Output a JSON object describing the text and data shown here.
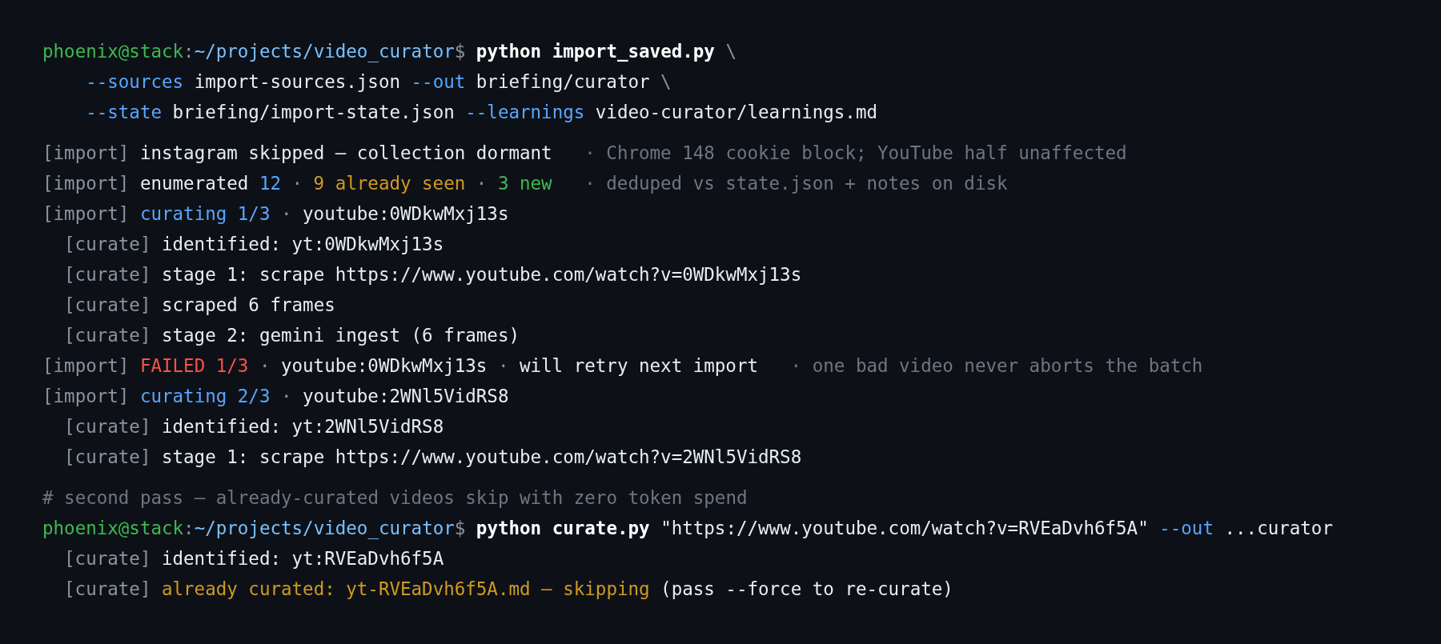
{
  "blocks": [
    {
      "lines": [
        {
          "kind": "command",
          "prompt": {
            "user": "phoenix@stack",
            "sep": ":",
            "path": "~/projects/video_curator",
            "sign": "$"
          },
          "segments": [
            {
              "kind": "bold",
              "text": "python import_saved.py"
            },
            {
              "kind": "dim",
              "text": "\\"
            }
          ]
        },
        {
          "kind": "continuation",
          "segments": [
            {
              "kind": "flag",
              "text": "--sources"
            },
            {
              "kind": "text",
              "text": "import-sources.json"
            },
            {
              "kind": "flag",
              "text": "--out"
            },
            {
              "kind": "text",
              "text": "briefing/curator"
            },
            {
              "kind": "dim",
              "text": "\\"
            }
          ]
        },
        {
          "kind": "continuation",
          "segments": [
            {
              "kind": "flag",
              "text": "--state"
            },
            {
              "kind": "text",
              "text": "briefing/import-state.json"
            },
            {
              "kind": "flag",
              "text": "--learnings"
            },
            {
              "kind": "text",
              "text": "video-curator/learnings.md"
            }
          ]
        }
      ]
    },
    {
      "lines": [
        {
          "kind": "log",
          "segments": [
            {
              "kind": "dim",
              "text": "[import]"
            },
            {
              "kind": "text",
              "text": "instagram skipped — collection dormant"
            },
            {
              "kind": "note",
              "text": "· Chrome 148 cookie block; YouTube half unaffected"
            }
          ]
        },
        {
          "kind": "log",
          "segments": [
            {
              "kind": "dim",
              "text": "[import]"
            },
            {
              "kind": "text",
              "text": "enumerated"
            },
            {
              "kind": "accent",
              "text": "12"
            },
            {
              "kind": "dim",
              "text": "·"
            },
            {
              "kind": "warn",
              "text": "9 already seen"
            },
            {
              "kind": "dim",
              "text": "·"
            },
            {
              "kind": "ok",
              "text": "3 new"
            },
            {
              "kind": "note",
              "text": "· deduped vs state.json + notes on disk"
            }
          ]
        },
        {
          "kind": "log",
          "segments": [
            {
              "kind": "dim",
              "text": "[import]"
            },
            {
              "kind": "accent",
              "text": "curating 1/3"
            },
            {
              "kind": "dim",
              "text": "·"
            },
            {
              "kind": "text",
              "text": "youtube:0WDkwMxj13s"
            }
          ]
        },
        {
          "kind": "sublog",
          "segments": [
            {
              "kind": "dim",
              "text": "[curate]"
            },
            {
              "kind": "text",
              "text": "identified: yt:0WDkwMxj13s"
            }
          ]
        },
        {
          "kind": "sublog",
          "segments": [
            {
              "kind": "dim",
              "text": "[curate]"
            },
            {
              "kind": "text",
              "text": "stage 1: scrape https://www.youtube.com/watch?v=0WDkwMxj13s"
            }
          ]
        },
        {
          "kind": "sublog",
          "segments": [
            {
              "kind": "dim",
              "text": "[curate]"
            },
            {
              "kind": "text",
              "text": "scraped 6 frames"
            }
          ]
        },
        {
          "kind": "sublog",
          "segments": [
            {
              "kind": "dim",
              "text": "[curate]"
            },
            {
              "kind": "text",
              "text": "stage 2: gemini ingest (6 frames)"
            }
          ]
        },
        {
          "kind": "log",
          "segments": [
            {
              "kind": "dim",
              "text": "[import]"
            },
            {
              "kind": "error",
              "text": "FAILED 1/3"
            },
            {
              "kind": "dim",
              "text": "·"
            },
            {
              "kind": "text",
              "text": "youtube:0WDkwMxj13s"
            },
            {
              "kind": "dim",
              "text": "·"
            },
            {
              "kind": "text",
              "text": "will retry next import"
            },
            {
              "kind": "note",
              "text": "· one bad video never aborts the batch"
            }
          ]
        },
        {
          "kind": "log",
          "segments": [
            {
              "kind": "dim",
              "text": "[import]"
            },
            {
              "kind": "accent",
              "text": "curating 2/3"
            },
            {
              "kind": "dim",
              "text": "·"
            },
            {
              "kind": "text",
              "text": "youtube:2WNl5VidRS8"
            }
          ]
        },
        {
          "kind": "sublog",
          "segments": [
            {
              "kind": "dim",
              "text": "[curate]"
            },
            {
              "kind": "text",
              "text": "identified: yt:2WNl5VidRS8"
            }
          ]
        },
        {
          "kind": "sublog",
          "segments": [
            {
              "kind": "dim",
              "text": "[curate]"
            },
            {
              "kind": "text",
              "text": "stage 1: scrape https://www.youtube.com/watch?v=2WNl5VidRS8"
            }
          ]
        }
      ]
    },
    {
      "lines": [
        {
          "kind": "log",
          "segments": [
            {
              "kind": "comment",
              "text": "# second pass — already-curated videos skip with zero token spend"
            }
          ]
        },
        {
          "kind": "command",
          "prompt": {
            "user": "phoenix@stack",
            "sep": ":",
            "path": "~/projects/video_curator",
            "sign": "$"
          },
          "segments": [
            {
              "kind": "bold",
              "text": "python curate.py"
            },
            {
              "kind": "text",
              "text": "\"https://www.youtube.com/watch?v=RVEaDvh6f5A\""
            },
            {
              "kind": "flag",
              "text": "--out"
            },
            {
              "kind": "text",
              "text": "...curator"
            }
          ]
        },
        {
          "kind": "sublog",
          "segments": [
            {
              "kind": "dim",
              "text": "[curate]"
            },
            {
              "kind": "text",
              "text": "identified: yt:RVEaDvh6f5A"
            }
          ]
        },
        {
          "kind": "sublog",
          "segments": [
            {
              "kind": "dim",
              "text": "[curate]"
            },
            {
              "kind": "warn",
              "text": "already curated: yt-RVEaDvh6f5A.md — skipping"
            },
            {
              "kind": "text",
              "text": "(pass --force to re-curate)"
            }
          ]
        }
      ]
    }
  ]
}
